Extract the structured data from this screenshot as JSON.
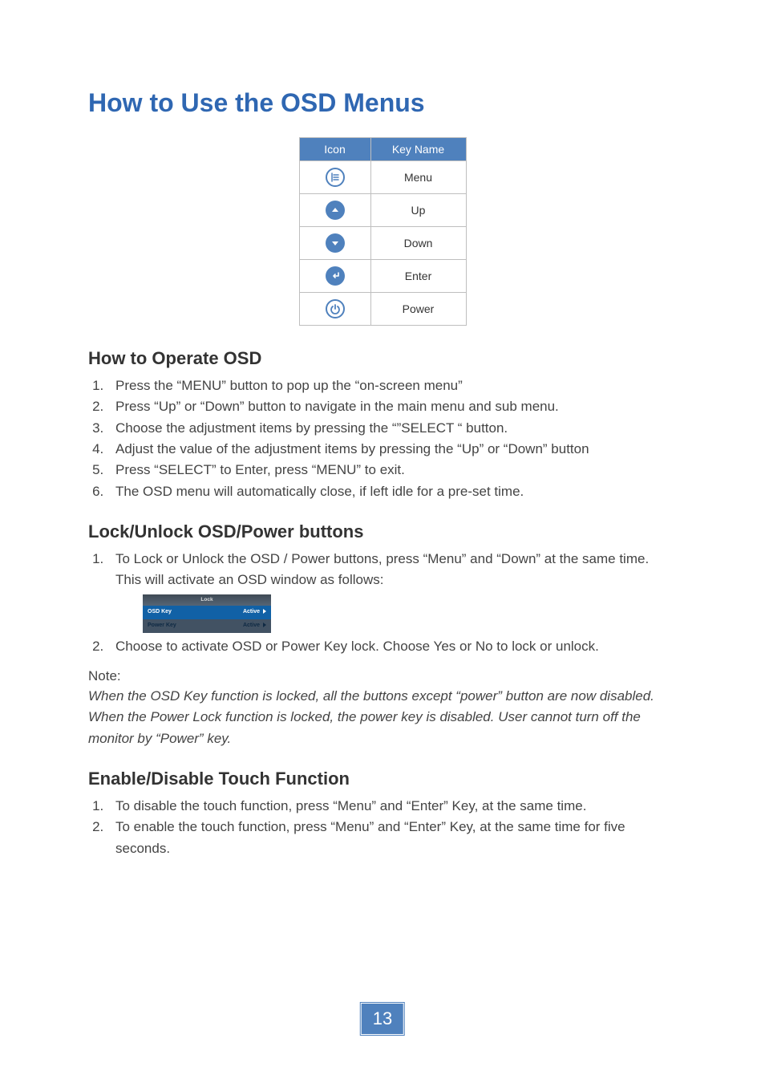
{
  "title": "How to Use the OSD Menus",
  "icon_table": {
    "headers": {
      "icon": "Icon",
      "name": "Key Name"
    },
    "rows": [
      {
        "icon": "menu-icon",
        "name": "Menu"
      },
      {
        "icon": "up-icon",
        "name": "Up"
      },
      {
        "icon": "down-icon",
        "name": "Down"
      },
      {
        "icon": "enter-icon",
        "name": "Enter"
      },
      {
        "icon": "power-icon",
        "name": "Power"
      }
    ]
  },
  "sections": {
    "operate": {
      "heading": "How to Operate OSD",
      "items": [
        "Press the “MENU” button to pop up the “on-screen menu”",
        "Press “Up” or “Down” button to navigate in the main menu and sub menu.",
        "Choose the adjustment items by pressing the “”SELECT “ button.",
        "Adjust the value of the adjustment items by pressing the “Up” or “Down” button",
        "Press “SELECT” to Enter, press “MENU” to exit.",
        "The OSD menu will automatically close, if left idle for a pre-set time."
      ]
    },
    "lock": {
      "heading": "Lock/Unlock OSD/Power buttons",
      "item1": "To Lock or Unlock the OSD / Power buttons, press “Menu” and “Down” at the same time. This will activate an OSD window as follows:",
      "lock_window": {
        "title": "Lock",
        "rows": [
          {
            "label": "OSD Key",
            "value": "Active"
          },
          {
            "label": "Power Key",
            "value": "Active"
          }
        ]
      },
      "item2": "Choose to activate OSD or Power Key lock. Choose Yes or No to lock or unlock.",
      "note_label": "Note:",
      "note_body": "When the OSD Key function is locked, all the buttons except “power” button are now disabled. When the Power Lock function is locked, the power key is disabled. User cannot turn off the monitor by “Power” key."
    },
    "touch": {
      "heading": "Enable/Disable Touch Function",
      "items": [
        "To disable the touch function, press “Menu” and “Enter” Key, at the same time.",
        "To enable the touch function, press “Menu” and “Enter” Key, at the same time for five seconds."
      ]
    }
  },
  "page_number": "13"
}
